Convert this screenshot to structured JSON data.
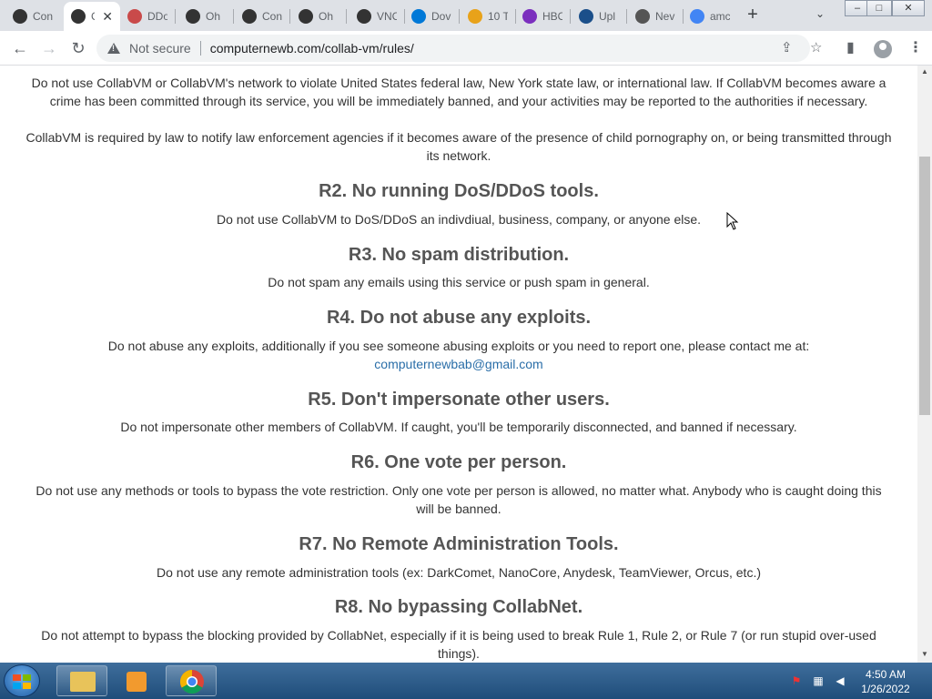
{
  "browser": {
    "tabs": [
      {
        "title": "Con",
        "favicon": "collabvm-icon",
        "color": "#333"
      },
      {
        "title": "C",
        "favicon": "collabvm-icon",
        "color": "#333",
        "active": true
      },
      {
        "title": "DDo",
        "favicon": "ddos-icon",
        "color": "#c94a4a"
      },
      {
        "title": "Oh",
        "favicon": "collabvm-icon",
        "color": "#333"
      },
      {
        "title": "Con",
        "favicon": "collabvm-icon",
        "color": "#333"
      },
      {
        "title": "Oh",
        "favicon": "collabvm-icon",
        "color": "#333"
      },
      {
        "title": "VNC",
        "favicon": "vnc-icon",
        "color": "#333"
      },
      {
        "title": "Dov",
        "favicon": "windows-icon",
        "color": "#0078d7"
      },
      {
        "title": "10 T",
        "favicon": "c-icon",
        "color": "#e8a21a"
      },
      {
        "title": "HBO",
        "favicon": "hbo-icon",
        "color": "#7b2fbe"
      },
      {
        "title": "Upl",
        "favicon": "upload-icon",
        "color": "#1b4f8a"
      },
      {
        "title": "Nev",
        "favicon": "chrome-icon",
        "color": "#555"
      },
      {
        "title": "amc",
        "favicon": "google-icon",
        "color": "#4285f4"
      }
    ],
    "new_tab": "+",
    "tab_close": "✕",
    "tab_search": "⌄",
    "window_buttons": {
      "minimize": "–",
      "maximize": "□",
      "close": "✕"
    },
    "nav": {
      "back": "←",
      "forward": "→",
      "reload": "↻"
    },
    "security_label": "Not secure",
    "url": "computernewb.com/collab-vm/rules/",
    "toolbar_icons": {
      "share": "⇪",
      "star": "☆",
      "sidebar": "▮",
      "menu": "⋮"
    }
  },
  "content": {
    "r1_para1": "Do not use CollabVM or CollabVM's network to violate United States federal law, New York state law, or international law. If CollabVM becomes aware a crime has been committed through its service, you will be immediately banned, and your activities may be reported to the authorities if necessary.",
    "r1_para2": "CollabVM is required by law to notify law enforcement agencies if it becomes aware of the presence of child pornography on, or being transmitted through its network.",
    "rules": [
      {
        "title": "R2. No running DoS/DDoS tools.",
        "text": "Do not use CollabVM to DoS/DDoS an indivdiual, business, company, or anyone else."
      },
      {
        "title": "R3. No spam distribution.",
        "text": "Do not spam any emails using this service or push spam in general."
      },
      {
        "title": "R4. Do not abuse any exploits.",
        "text": "Do not abuse any exploits, additionally if you see someone abusing exploits or you need to report one, please contact me at:",
        "link": "computernewbab@gmail.com"
      },
      {
        "title": "R5. Don't impersonate other users.",
        "text": "Do not impersonate other members of CollabVM. If caught, you'll be temporarily disconnected, and banned if necessary."
      },
      {
        "title": "R6. One vote per person.",
        "text": "Do not use any methods or tools to bypass the vote restriction. Only one vote per person is allowed, no matter what. Anybody who is caught doing this will be banned."
      },
      {
        "title": "R7. No Remote Administration Tools.",
        "text": "Do not use any remote administration tools (ex: DarkComet, NanoCore, Anydesk, TeamViewer, Orcus, etc.)"
      },
      {
        "title": "R8. No bypassing CollabNet.",
        "text": "Do not attempt to bypass the blocking provided by CollabNet, especially if it is being used to break Rule 1, Rule 2, or Rule 7 (or run stupid over-used things)."
      }
    ]
  },
  "taskbar": {
    "time": "4:50 AM",
    "date": "1/26/2022"
  }
}
